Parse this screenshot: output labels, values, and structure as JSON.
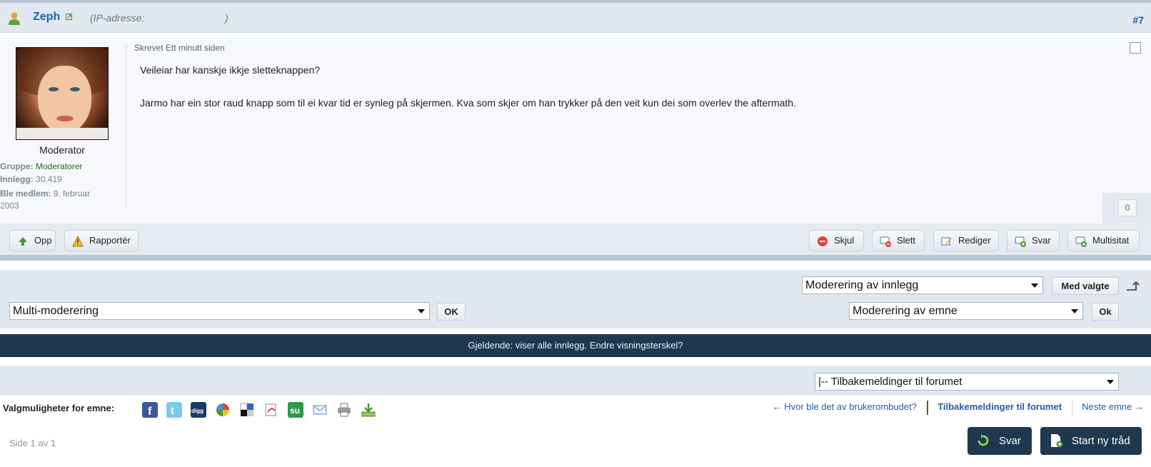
{
  "post": {
    "username": "Zeph",
    "ip_label": "(IP-adresse:",
    "ip_close": ")",
    "post_number": "#7",
    "written": "Skrevet  Ett  minutt  siden",
    "message_line1": "Veileiar har kanskje ikkje sletteknappen?",
    "message_line2": "Jarmo har ein stor raud knapp som til ei kvar tid er synleg på skjermen. Kva som skjer om han trykker på den veit kun dei som overlev the aftermath.",
    "like_count": "0"
  },
  "author": {
    "rank": "Moderator",
    "group_label": "Gruppe:",
    "group_value": "Moderatorer",
    "posts_label": "Innlegg:",
    "posts_value": "30.419",
    "joined_label": "Ble medlem:",
    "joined_value_1": "9.  februar",
    "joined_value_2": "2003"
  },
  "actions": {
    "up": "Opp",
    "report": "Rapportér",
    "hide": "Skjul",
    "delete": "Slett",
    "edit": "Rediger",
    "reply": "Svar",
    "multiquote": "Multisitat"
  },
  "moderation": {
    "post_mod_select": "Moderering  av innlegg",
    "with_selected": "Med  valgte",
    "multi_mod_select": "Multi-moderering",
    "ok_upper": "OK",
    "topic_mod_select": "Moderering  av emne",
    "ok": "Ok"
  },
  "banner": "Gjeldende:  viser alle  innlegg.  Endre visningsterskel?",
  "forum_jump": "|--  Tilbakemeldinger  til  forumet",
  "topic_options": {
    "label": "Valgmuligheter for  emne:",
    "share_icons": [
      "facebook-icon",
      "twitter-icon",
      "digg-icon",
      "google-icon",
      "delicious-icon",
      "bookmark-icon",
      "stumbleupon-icon",
      "email-icon",
      "print-icon",
      "download-icon"
    ]
  },
  "nav": {
    "prev": "← Hvor  ble  det av brukerombudet?",
    "current": "Tilbakemeldinger til forumet",
    "next": "Neste  emne →"
  },
  "page_info": "Side  1  av  1",
  "buttons": {
    "reply": "Svar",
    "new_thread": "Start  ny  tråd"
  },
  "colors": {
    "link": "#1f5fa8",
    "dark_bar": "#20384f",
    "panel": "#e2e8ef"
  }
}
